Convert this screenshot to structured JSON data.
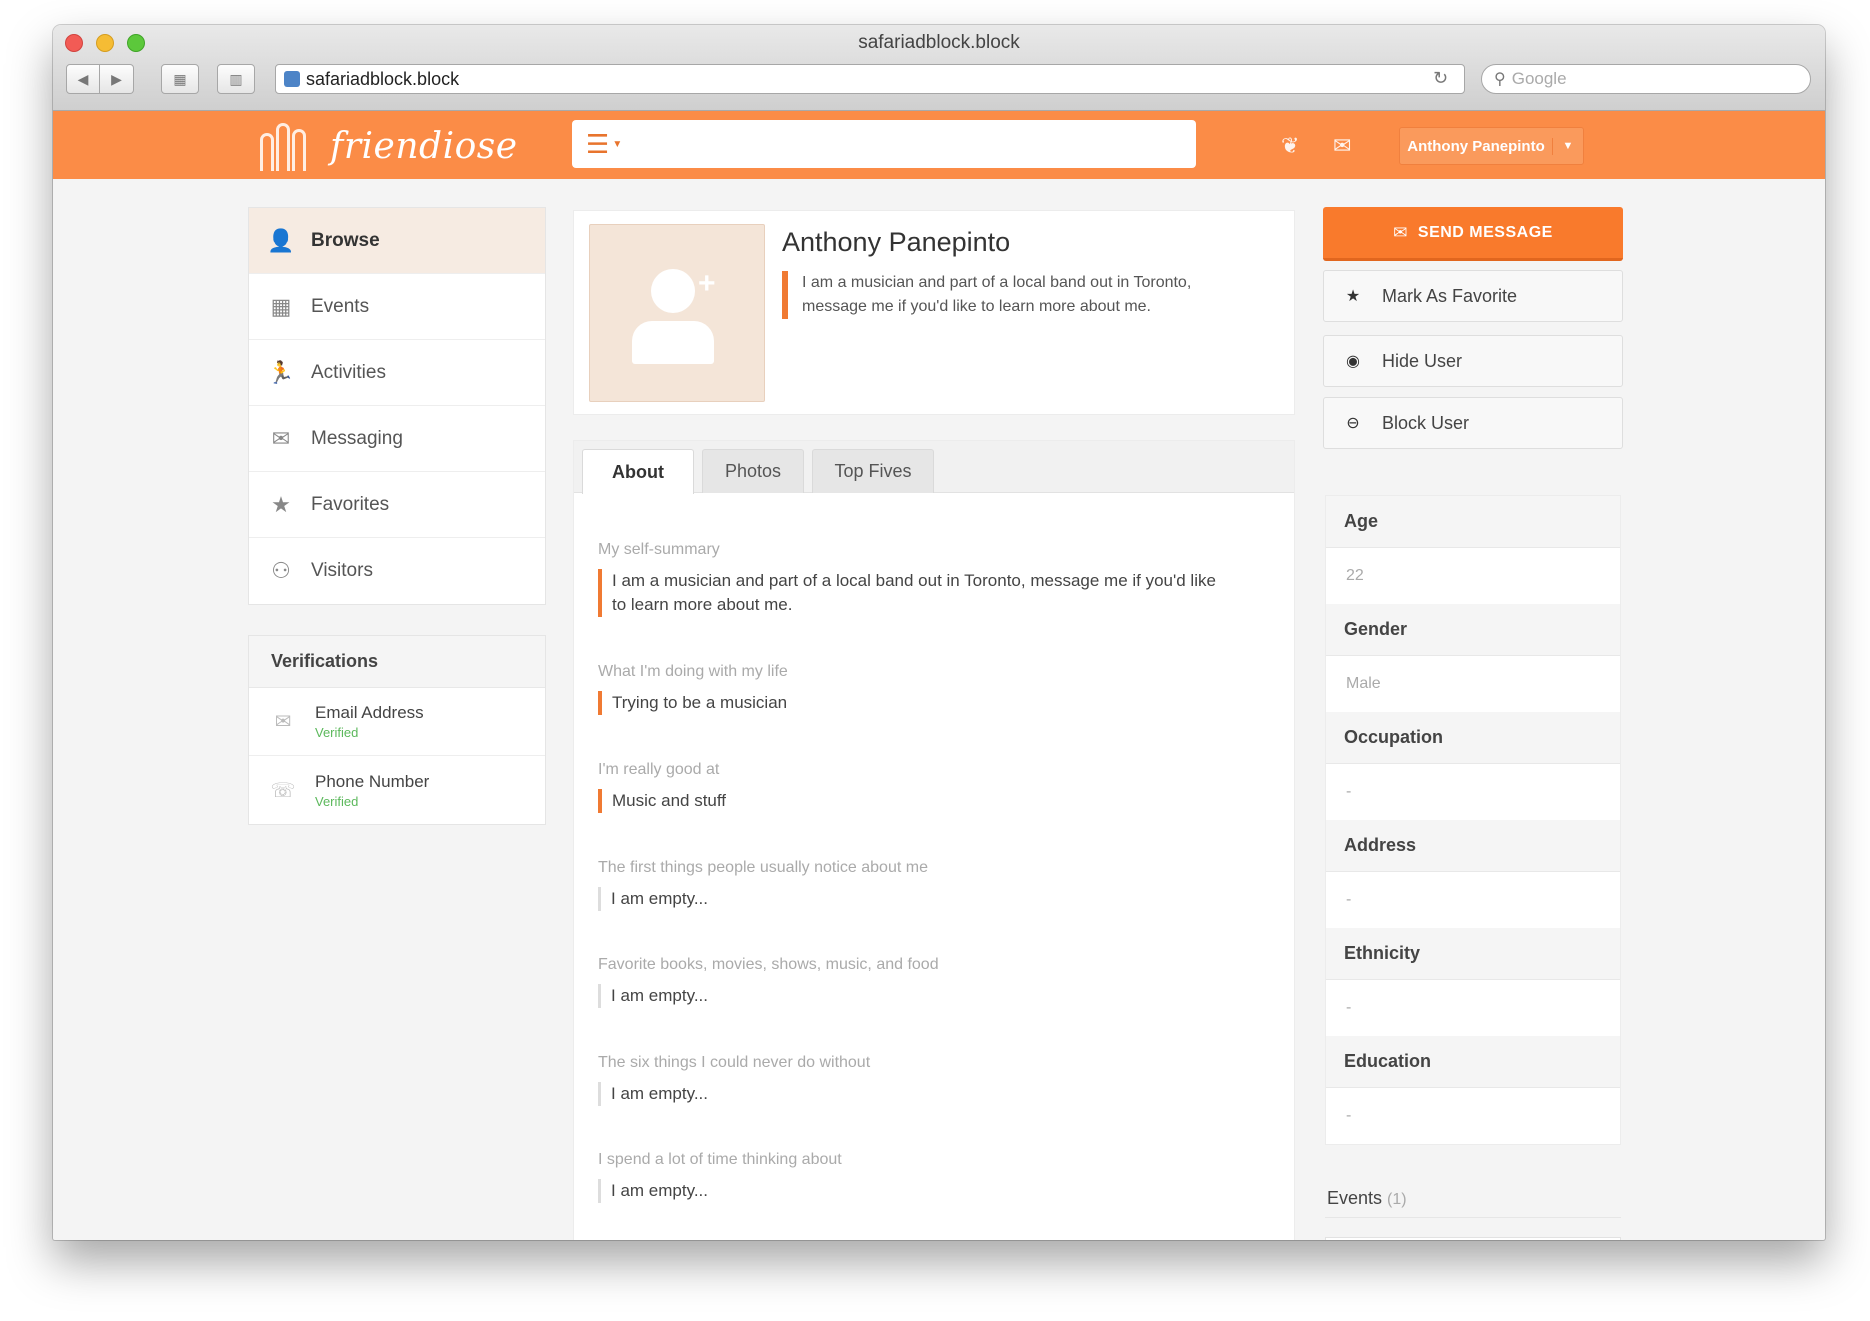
{
  "browser": {
    "window_title": "safariadblock.block",
    "url": "safariadblock.block",
    "search_placeholder": "Google"
  },
  "header": {
    "brand": "friendiose",
    "user_name": "Anthony Panepinto"
  },
  "sidebar": {
    "items": [
      {
        "label": "Browse",
        "icon": "user-icon",
        "active": true
      },
      {
        "label": "Events",
        "icon": "calendar-icon"
      },
      {
        "label": "Activities",
        "icon": "running-icon"
      },
      {
        "label": "Messaging",
        "icon": "envelope-icon"
      },
      {
        "label": "Favorites",
        "icon": "star-icon"
      },
      {
        "label": "Visitors",
        "icon": "visitors-icon"
      }
    ]
  },
  "verifications": {
    "title": "Verifications",
    "items": [
      {
        "label": "Email Address",
        "status": "Verified",
        "icon": "envelope-icon"
      },
      {
        "label": "Phone Number",
        "status": "Verified",
        "icon": "phone-icon"
      }
    ]
  },
  "profile": {
    "name": "Anthony Panepinto",
    "bio": "I am a musician and part of a local band out in Toronto, message me if you'd like to learn more about me."
  },
  "tabs": [
    "About",
    "Photos",
    "Top Fives"
  ],
  "about": [
    {
      "question": "My self-summary",
      "answer": "I am a musician and part of a local band out in Toronto, message me if you'd like to learn more about me.",
      "empty": false
    },
    {
      "question": "What I'm doing with my life",
      "answer": "Trying to be a musician",
      "empty": false
    },
    {
      "question": "I'm really good at",
      "answer": "Music and stuff",
      "empty": false
    },
    {
      "question": "The first things people usually notice about me",
      "answer": "I am empty...",
      "empty": true
    },
    {
      "question": "Favorite books, movies, shows, music, and food",
      "answer": "I am empty...",
      "empty": true
    },
    {
      "question": "The six things I could never do without",
      "answer": "I am empty...",
      "empty": true
    },
    {
      "question": "I spend a lot of time thinking about",
      "answer": "I am empty...",
      "empty": true
    }
  ],
  "actions": {
    "send_message": "SEND MESSAGE",
    "favorite": "Mark As Favorite",
    "hide": "Hide User",
    "block": "Block User"
  },
  "details": [
    {
      "label": "Age",
      "value": "22"
    },
    {
      "label": "Gender",
      "value": "Male"
    },
    {
      "label": "Occupation",
      "value": "-"
    },
    {
      "label": "Address",
      "value": "-"
    },
    {
      "label": "Ethnicity",
      "value": "-"
    },
    {
      "label": "Education",
      "value": "-"
    }
  ],
  "events": {
    "label": "Events",
    "count": "(1)"
  },
  "colors": {
    "accent": "#fb8c47",
    "accent_dark": "#f07a33",
    "verified": "#5cb85c"
  }
}
